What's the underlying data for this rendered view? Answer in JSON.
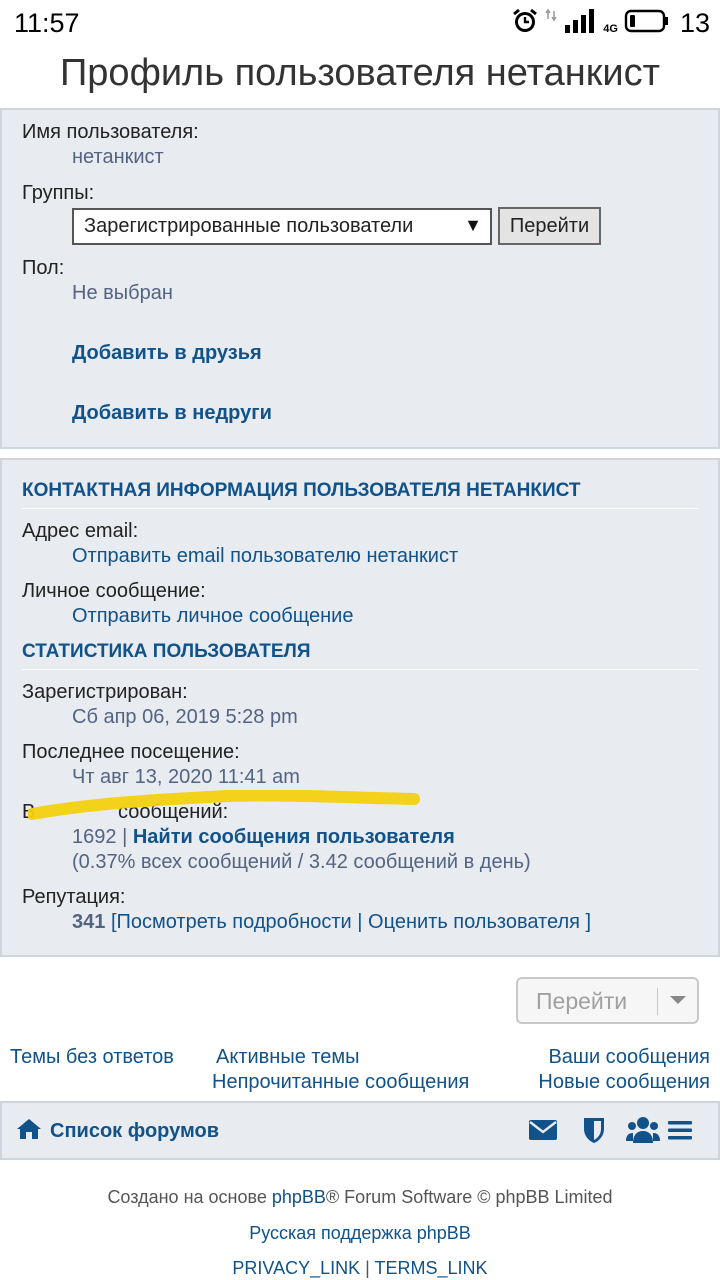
{
  "status_bar": {
    "time": "11:57",
    "network": "4G",
    "battery": "13",
    "icons": [
      "alarm-icon",
      "data-arrows-icon",
      "signal-icon",
      "battery-icon"
    ]
  },
  "page": {
    "title": "Профиль пользователя нетанкист"
  },
  "profile": {
    "username_label": "Имя пользователя:",
    "username_value": "нетанкист",
    "groups_label": "Группы:",
    "groups_selected": "Зарегистрированные пользователи",
    "groups_go": "Перейти",
    "gender_label": "Пол:",
    "gender_value": "Не выбран",
    "add_friend": "Добавить в друзья",
    "add_foe": "Добавить в недруги"
  },
  "contact": {
    "heading": "КОНТАКТНАЯ ИНФОРМАЦИЯ ПОЛЬЗОВАТЕЛЯ НЕТАНКИСТ",
    "email_label": "Адрес email:",
    "email_link": "Отправить email пользователю нетанкист",
    "pm_label": "Личное сообщение:",
    "pm_link": "Отправить личное сообщение"
  },
  "stats": {
    "heading": "СТАТИСТИКА ПОЛЬЗОВАТЕЛЯ",
    "registered_label": "Зарегистрирован:",
    "registered_value": "Сб апр 06, 2019 5:28 pm",
    "last_visit_label": "Последнее посещение:",
    "last_visit_value": "Чт авг 13, 2020 11:41 am",
    "posts_label_partial_start": "В",
    "posts_label_partial_end": "сообщений:",
    "posts_count": "1692",
    "posts_separator": "|",
    "find_posts": "Найти сообщения пользователя",
    "posts_percent": "(0.37% всех сообщений / 3.42 сообщений в день)",
    "reputation_label": "Репутация:",
    "reputation_value": "341",
    "rep_open": "[",
    "rep_details": "Посмотреть подробности",
    "rep_sep": "|",
    "rep_rate": "Оценить пользователя",
    "rep_close": "]"
  },
  "jump": {
    "label": "Перейти"
  },
  "quick_links": {
    "unanswered": "Темы без ответов",
    "active": "Активные темы",
    "your_posts": "Ваши сообщения",
    "unread": "Непрочитанные сообщения",
    "new_posts": "Новые сообщения"
  },
  "navbar": {
    "forums": "Список форумов",
    "icons": [
      "home-icon",
      "envelope-icon",
      "shield-icon",
      "users-icon",
      "menu-icon"
    ]
  },
  "footer": {
    "powered_pre": "Создано на основе",
    "phpbb": "phpBB",
    "powered_post": "® Forum Software © phpBB Limited",
    "support": "Русская поддержка phpBB",
    "privacy": "PRIVACY_LINK",
    "sep": "|",
    "terms": "TERMS_LINK"
  },
  "colors": {
    "link": "#105289",
    "value": "#536482",
    "panel_bg": "#e8ebef",
    "highlight": "#f2d10e"
  }
}
